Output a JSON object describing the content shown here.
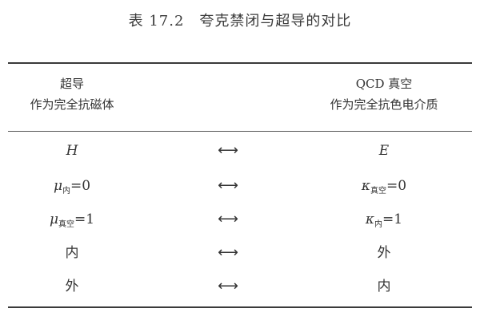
{
  "caption": "表 17.2　夸克禁闭与超导的对比",
  "header": {
    "left": {
      "title": "超导",
      "subtitle": "作为完全抗磁体"
    },
    "right": {
      "title": "QCD 真空",
      "subtitle": "作为完全抗色电介质"
    }
  },
  "arrow": "⟷",
  "rows": [
    {
      "left": {
        "sym": "H",
        "sub": "",
        "rest": ""
      },
      "right": {
        "sym": "E",
        "sub": "",
        "rest": ""
      }
    },
    {
      "left": {
        "sym": "μ",
        "sub": "内",
        "rest": "=0"
      },
      "right": {
        "sym": "κ",
        "sub": "真空",
        "rest": "=0"
      }
    },
    {
      "left": {
        "sym": "μ",
        "sub": "真空",
        "rest": "=1"
      },
      "right": {
        "sym": "κ",
        "sub": "内",
        "rest": "=1"
      }
    },
    {
      "left": {
        "sym": "内",
        "sub": "",
        "rest": ""
      },
      "right": {
        "sym": "外",
        "sub": "",
        "rest": ""
      }
    },
    {
      "left": {
        "sym": "外",
        "sub": "",
        "rest": ""
      },
      "right": {
        "sym": "内",
        "sub": "",
        "rest": ""
      }
    }
  ]
}
